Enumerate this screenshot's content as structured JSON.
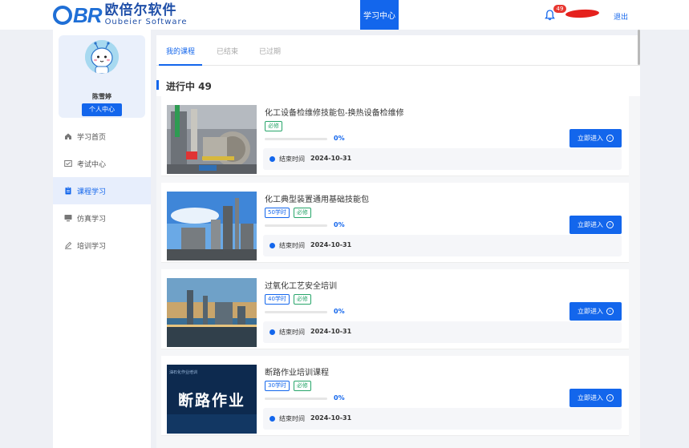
{
  "header": {
    "logo_mark": "BR",
    "logo_cn": "欧倍尔软件",
    "logo_en": "Oubeier  Software",
    "nav_active": "学习中心",
    "notification_count": "49",
    "logout": "退出"
  },
  "sidebar": {
    "username": "陈雪婷",
    "personal_center": "个人中心",
    "items": [
      {
        "label": "学习首页",
        "icon": "home-icon"
      },
      {
        "label": "考试中心",
        "icon": "exam-icon"
      },
      {
        "label": "课程学习",
        "icon": "course-icon",
        "active": true
      },
      {
        "label": "仿真学习",
        "icon": "monitor-icon"
      },
      {
        "label": "培训学习",
        "icon": "pen-icon"
      }
    ]
  },
  "tabs": [
    {
      "label": "我的课程",
      "active": true
    },
    {
      "label": "已结束"
    },
    {
      "label": "已过期"
    }
  ],
  "section_title": "进行中 49",
  "courses": [
    {
      "title": "化工设备检维修技能包-换热设备检维修",
      "hours": null,
      "required": "必修",
      "progress": "0%",
      "progress_value": 0,
      "end_label": "结束时间",
      "end_date": "2024-10-31",
      "button": "立即进入"
    },
    {
      "title": "化工典型装置通用基础技能包",
      "hours": "50学时",
      "required": "必修",
      "progress": "0%",
      "progress_value": 0,
      "end_label": "结束时间",
      "end_date": "2024-10-31",
      "button": "立即进入"
    },
    {
      "title": "过氧化工艺安全培训",
      "hours": "40学时",
      "required": "必修",
      "progress": "0%",
      "progress_value": 0,
      "end_label": "结束时间",
      "end_date": "2024-10-31",
      "button": "立即进入"
    },
    {
      "title": "断路作业培训课程",
      "hours": "30学时",
      "required": "必修",
      "progress": "0%",
      "progress_value": 0,
      "end_label": "结束时间",
      "end_date": "2024-10-31",
      "button": "立即进入",
      "thumb_text": "断路作业",
      "thumb_small": "油石化作业培训"
    }
  ],
  "colors": {
    "accent": "#1366ec",
    "required_tag": "#27a56a",
    "badge": "#e8362f"
  }
}
